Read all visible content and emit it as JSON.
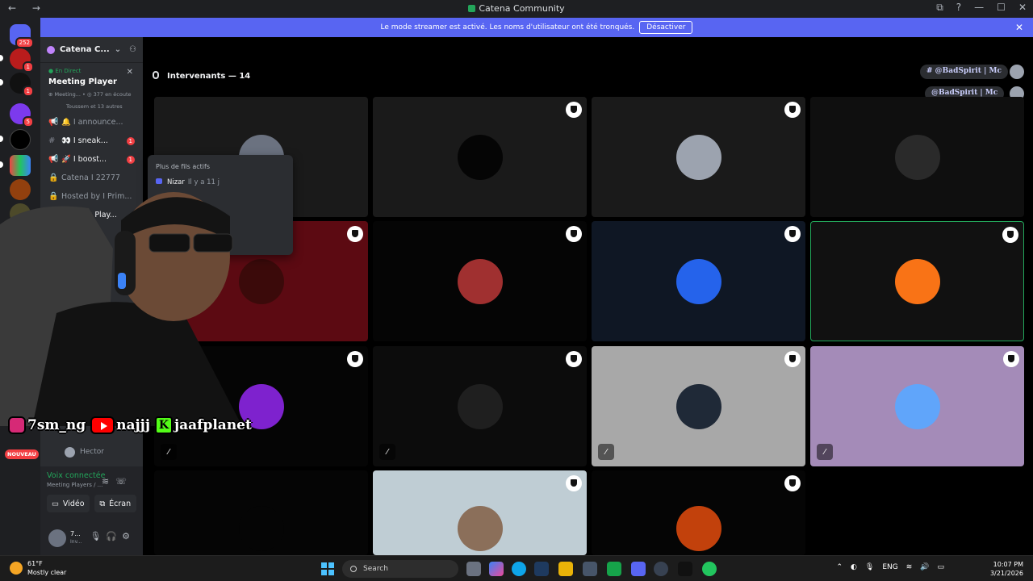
{
  "window": {
    "title": "Catena Community",
    "nav_glyphs": "← →",
    "controls": [
      "⧉",
      "?",
      "—",
      "☐",
      "✕"
    ]
  },
  "banner": {
    "text": "Le mode streamer est activé. Les noms d'utilisateur ont été tronqués.",
    "button": "Désactiver",
    "close": "✕"
  },
  "rail": {
    "home_badge": "252",
    "badges": [
      "1",
      "1",
      "5"
    ]
  },
  "sidebar": {
    "guild_name": "Catena C...",
    "live": {
      "label": "● En Direct",
      "title": "Meeting Player",
      "meta": "⊕ Meeting... • ◎ 377 en écoute",
      "listeners": "Toussem et 13 autres",
      "close": "✕"
    },
    "channels": [
      {
        "icon": "📢",
        "label": "🔔 I announce...",
        "badge": ""
      },
      {
        "icon": "#",
        "label": "👀 I sneak...",
        "badge": "1"
      },
      {
        "icon": "📢",
        "label": "🚀 I boost...",
        "badge": "1"
      },
      {
        "icon": "🔒",
        "label": "Catena I 22777",
        "badge": ""
      },
      {
        "icon": "🔒",
        "label": "Hosted by I Prim...",
        "badge": ""
      },
      {
        "icon": "🔊",
        "label": "Meeting Play...",
        "badge": ""
      }
    ],
    "hector": "Hector",
    "new_badge": "NOUVEAU",
    "voice": {
      "status": "Voix connectée",
      "channel": "Meeting Players / ...",
      "video": "Vidéo",
      "screen": "Écran"
    },
    "user": {
      "name": "7...",
      "status": "Inv..."
    }
  },
  "main": {
    "speakers": "Intervenants — 14",
    "chips": [
      "# @BadSpirit | Mc",
      "@BadSpirit | Mc"
    ],
    "badge_glyph": "C",
    "tiles": [
      {
        "bg": "#1a1a1a",
        "avatar": "#6b7280",
        "shield": false,
        "muted": false
      },
      {
        "bg": "#1a1a1a",
        "avatar": "#050505",
        "shield": true,
        "muted": false
      },
      {
        "bg": "#1a1a1a",
        "avatar": "#9ca3af",
        "shield": true,
        "muted": false
      },
      {
        "bg": "#0f0f0f",
        "avatar": "#2a2a2a",
        "shield": false,
        "muted": false
      },
      {
        "bg": "#5c0a12",
        "avatar": "#3b0a0a",
        "shield": true,
        "muted": false
      },
      {
        "bg": "#050505",
        "avatar": "#a03030",
        "shield": true,
        "muted": false
      },
      {
        "bg": "#0f1724",
        "avatar": "#2563eb",
        "shield": true,
        "muted": false
      },
      {
        "bg": "#111111",
        "avatar": "#f97316",
        "shield": true,
        "muted": false
      },
      {
        "bg": "#050505",
        "avatar": "#7e22ce",
        "shield": true,
        "muted": true
      },
      {
        "bg": "#0c0c0c",
        "avatar": "#1f1f1f",
        "shield": true,
        "muted": true
      },
      {
        "bg": "#a8a8a8",
        "avatar": "#1f2937",
        "shield": true,
        "muted": true
      },
      {
        "bg": "#a48bb8",
        "avatar": "#60a5fa",
        "shield": true,
        "muted": true
      },
      {
        "bg": "#050505",
        "avatar": "#050505",
        "shield": false,
        "muted": false
      },
      {
        "bg": "#bfcdd4",
        "avatar": "#8b6f5a",
        "shield": true,
        "muted": false
      },
      {
        "bg": "#050505",
        "avatar": "#c2410c",
        "shield": true,
        "muted": false
      }
    ]
  },
  "tooltip": {
    "heading": "Plus de fils actifs",
    "author": "Nizar",
    "when": "Il y a 11 j"
  },
  "overlay": {
    "instagram": "7sm_ng",
    "youtube": "najjj",
    "kick_letter": "K",
    "kick": "jaafplanet"
  },
  "taskbar": {
    "temp": "61°F",
    "weather": "Mostly clear",
    "search": "Search",
    "lang": "ENG",
    "time": "10:07 PM",
    "date": "3/21/2026"
  }
}
